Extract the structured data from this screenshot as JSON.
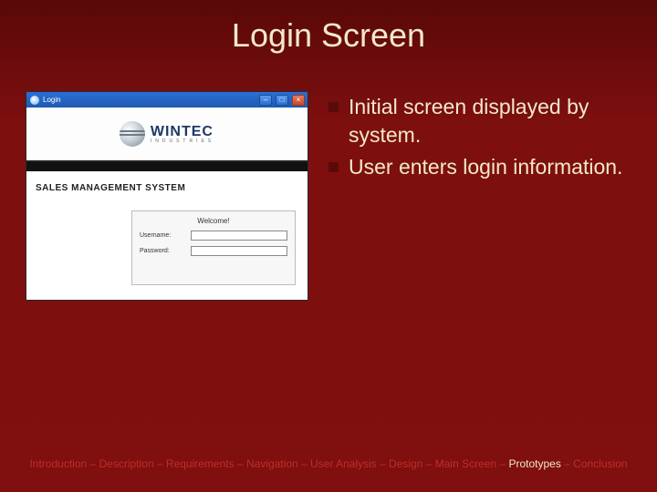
{
  "title": "Login Screen",
  "screenshot": {
    "window_title": "Login",
    "logo": {
      "name": "WINTEC",
      "sub": "INDUSTRIES"
    },
    "system_label": "SALES MANAGEMENT SYSTEM",
    "login_box": {
      "welcome": "Welcome!",
      "username_label": "Username:",
      "password_label": "Password:",
      "username_value": "",
      "password_value": ""
    },
    "win_buttons": {
      "min": "–",
      "max": "□",
      "close": "×"
    }
  },
  "bullets": [
    "Initial screen displayed by system.",
    "User enters login information."
  ],
  "footer": {
    "items": [
      "Introduction",
      "Description",
      "Requirements",
      "Navigation",
      "User Analysis",
      "Design",
      "Main Screen",
      "Prototypes",
      "Conclusion"
    ],
    "active_index": 7,
    "separator": " – "
  }
}
